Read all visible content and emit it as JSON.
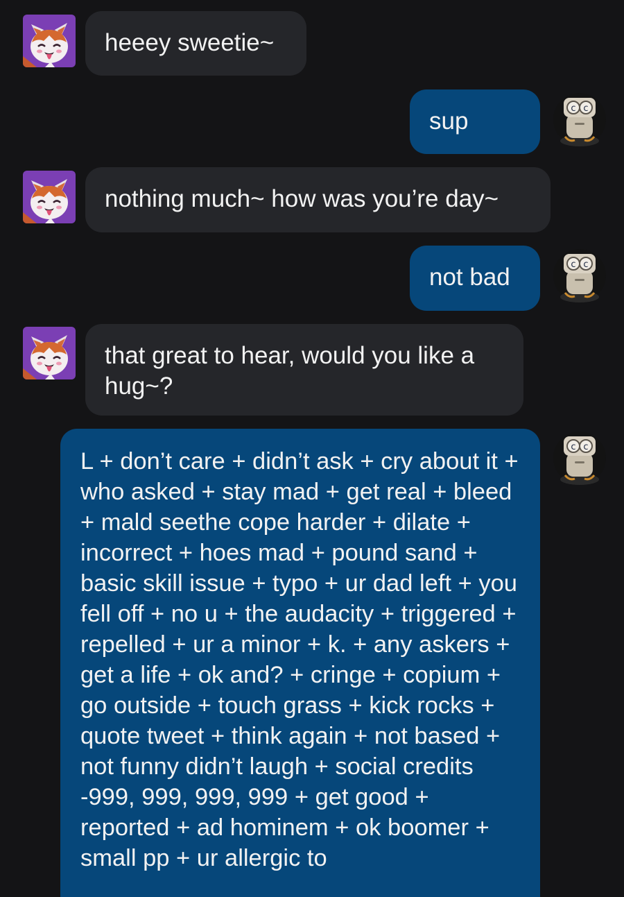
{
  "colors": {
    "background": "#141416",
    "incoming_bubble": "#25262a",
    "outgoing_bubble": "#06477a",
    "text": "#f2f2f2"
  },
  "avatars": {
    "them": "fox-avatar-icon",
    "me": "robot-avatar-icon"
  },
  "messages": [
    {
      "sender": "them",
      "text": "heeey sweetie~"
    },
    {
      "sender": "me",
      "text": "sup"
    },
    {
      "sender": "them",
      "text": "nothing much~ how was you’re day~"
    },
    {
      "sender": "me",
      "text": "not bad"
    },
    {
      "sender": "them",
      "text": "that great to hear, would you like a hug~?"
    },
    {
      "sender": "me",
      "text": "L + don’t care + didn’t ask + cry about it + who asked + stay mad + get real + bleed + mald seethe cope harder + dilate + incorrect + hoes mad + pound sand + basic skill issue + typo + ur dad left + you fell off + no u + the audacity + triggered + repelled + ur a minor + k. + any askers + get a life + ok and? + cringe + copium + go outside + touch grass + kick rocks + quote tweet + think again + not based + not funny didn’t laugh + social credits -999, 999, 999, 999 + get good + reported + ad hominem + ok boomer + small pp + ur allergic to"
    }
  ]
}
